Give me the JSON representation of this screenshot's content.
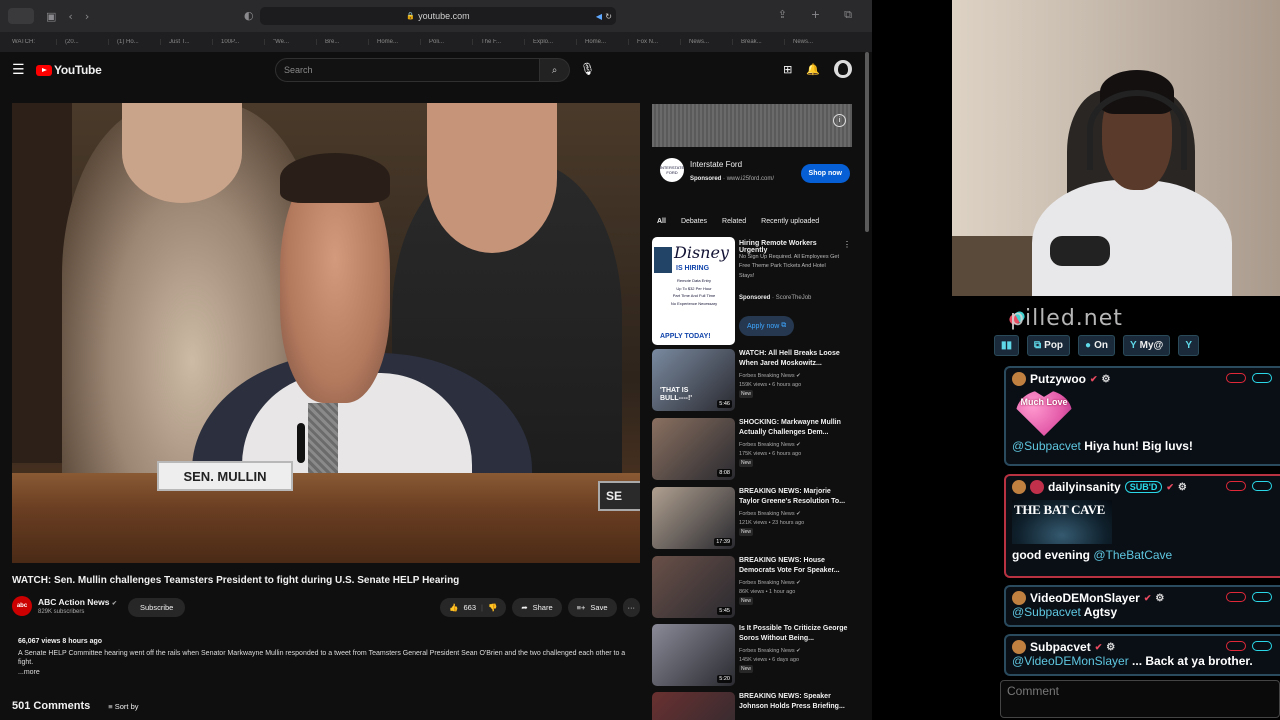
{
  "browser": {
    "url": "youtube.com",
    "tabs": [
      "WATCH:",
      "(20...",
      "(1) Ho...",
      "Just T...",
      "100P...",
      "\"We...",
      "Bre...",
      "Home...",
      "Poli...",
      "The F...",
      "Explo...",
      "Home...",
      "Fox N...",
      "News...",
      "Break...",
      "News..."
    ]
  },
  "youtube": {
    "logo_text": "YouTube",
    "search_placeholder": "Search"
  },
  "video": {
    "nameplate": "SEN. MULLIN",
    "nameplate2": "SE",
    "title": "WATCH: Sen. Mullin challenges Teamsters President to fight during U.S. Senate HELP Hearing",
    "channel_avatar_text": "abc",
    "channel_name": "ABC Action News",
    "subscribers": "829K subscribers",
    "subscribe_label": "Subscribe",
    "likes": "663",
    "share_label": "Share",
    "save_label": "Save",
    "more_label": "···",
    "views_time": "66,067 views  8 hours ago",
    "description": "A Senate HELP Committee hearing went off the rails when Senator Markwayne Mullin responded to a tweet from Teamsters General President Sean O'Brien and the two challenged each other to a fight.",
    "more_link": "...more",
    "comments_count": "501 Comments",
    "sort_label": "Sort by"
  },
  "ad": {
    "logo_text": "INTERSTATE FORD",
    "name": "Interstate Ford",
    "sponsored": "Sponsored",
    "url": "www.i25ford.com/",
    "shop_label": "Shop now"
  },
  "chips": [
    "All",
    "Debates",
    "Related",
    "Recently uploaded"
  ],
  "ad2": {
    "thumb_logo": "Disney",
    "thumb_hiring": "IS HIRING",
    "thumb_lines": [
      "Remote Data Entry",
      "Up To $32 Per Hour",
      "Part Time And Full Time",
      "No Experience Necessary"
    ],
    "thumb_apply": "APPLY TODAY!",
    "title": "Hiring Remote Workers Urgently",
    "text": "No Sign Up Required. All Employees Get Free Theme Park Tickets And Hotel Stays!",
    "sponsored": "Sponsored",
    "advertiser": "ScoreTheJob",
    "apply_label": "Apply now"
  },
  "recommendations": [
    {
      "title": "WATCH: All Hell Breaks Loose When Jared Moskowitz...",
      "channel": "Forbes Breaking News",
      "meta": "159K views • 6 hours ago",
      "badge": "New",
      "duration": "5:46",
      "thumb_text": "'THAT IS BULL----!'"
    },
    {
      "title": "SHOCKING: Markwayne Mullin Actually Challenges Dem...",
      "channel": "Forbes Breaking News",
      "meta": "175K views • 6 hours ago",
      "badge": "New",
      "duration": "8:08",
      "thumb_text": ""
    },
    {
      "title": "BREAKING NEWS: Marjorie Taylor Greene's Resolution To...",
      "channel": "Forbes Breaking News",
      "meta": "121K views • 23 hours ago",
      "badge": "New",
      "duration": "17:39",
      "thumb_text": ""
    },
    {
      "title": "BREAKING NEWS: House Democrats Vote For Speaker...",
      "channel": "Forbes Breaking News",
      "meta": "86K views • 1 hour ago",
      "badge": "New",
      "duration": "5:45",
      "thumb_text": ""
    },
    {
      "title": "Is It Possible To Criticize George Soros Without Being...",
      "channel": "Forbes Breaking News",
      "meta": "145K views • 6 days ago",
      "badge": "New",
      "duration": "5:20",
      "thumb_text": ""
    },
    {
      "title": "BREAKING NEWS: Speaker Johnson Holds Press Briefing...",
      "channel": "",
      "meta": "",
      "badge": "",
      "duration": "",
      "thumb_text": ""
    }
  ],
  "chat": {
    "brand": "pilled.net",
    "toolbar": [
      {
        "icon": "▮▮",
        "label": ""
      },
      {
        "icon": "⧉",
        "label": "Pop"
      },
      {
        "icon": "●",
        "label": "On"
      },
      {
        "icon": "Y",
        "label": "My@"
      },
      {
        "icon": "Y",
        "label": ""
      }
    ],
    "messages": [
      {
        "user": "Putzywoo",
        "emote": "Much Love",
        "mention": "@Subpacvet",
        "text": "Hiya hun! Big luvs!"
      },
      {
        "user": "dailyinsanity",
        "badge": "SUB'D",
        "emote": "THE BAT CAVE",
        "prefix": "good evening",
        "mention": "@TheBatCave",
        "text": ""
      },
      {
        "user": "VideoDEMonSlayer",
        "mention": "@Subpacvet",
        "text": "Agtsy"
      },
      {
        "user": "Subpacvet",
        "mention": "@VideoDEMonSlayer",
        "text": "... Back at ya brother."
      }
    ],
    "comment_placeholder": "Comment"
  }
}
